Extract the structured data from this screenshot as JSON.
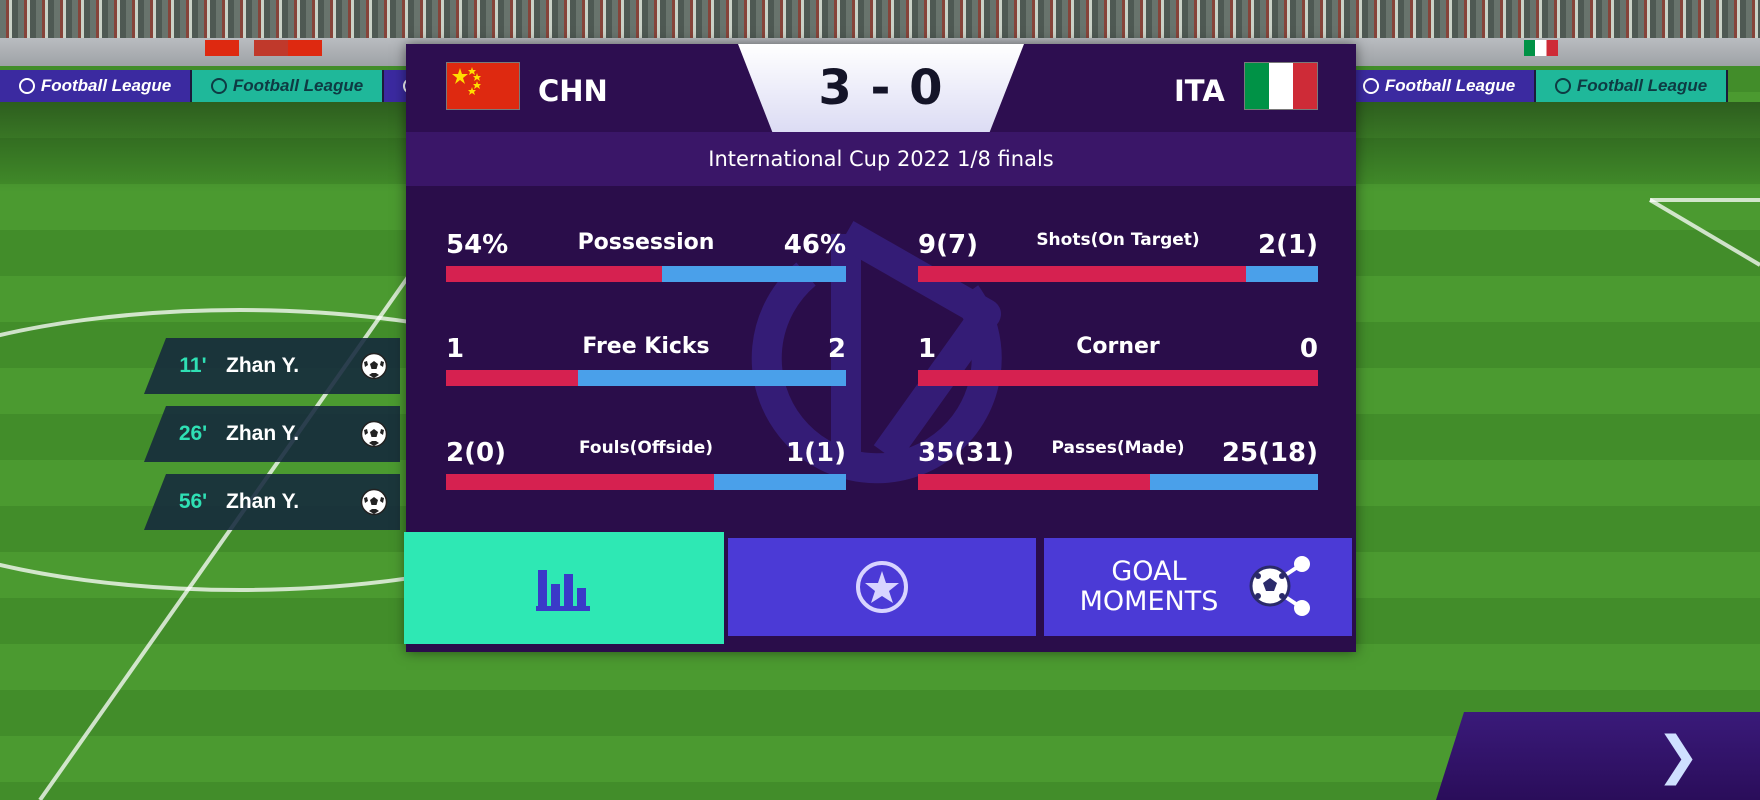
{
  "background": {
    "ad_boards": [
      {
        "text": "Football League",
        "style": "purple"
      },
      {
        "text": "Football League",
        "style": "teal"
      },
      {
        "text": "Football League",
        "style": "purple"
      },
      {
        "text": "",
        "style": "purple"
      },
      {
        "text": "",
        "style": "purple"
      },
      {
        "text": "",
        "style": "purple"
      },
      {
        "text": "Football League",
        "style": "teal"
      },
      {
        "text": "Football League",
        "style": "purple"
      },
      {
        "text": "Football League",
        "style": "teal"
      }
    ]
  },
  "goals": [
    {
      "minute": "11'",
      "scorer": "Zhan Y.",
      "icon": "soccer-ball-icon"
    },
    {
      "minute": "26'",
      "scorer": "Zhan Y.",
      "icon": "soccer-ball-icon"
    },
    {
      "minute": "56'",
      "scorer": "Zhan Y.",
      "icon": "soccer-ball-icon"
    }
  ],
  "match": {
    "home_code": "CHN",
    "away_code": "ITA",
    "score": "3 - 0",
    "competition": "International Cup 2022 1/8 finals",
    "home_flag": "china-flag",
    "away_flag": "italy-flag"
  },
  "stats": [
    {
      "label": "Possession",
      "home": "54%",
      "away": "46%",
      "home_share": 0.54,
      "label_size": "normal"
    },
    {
      "label": "Shots(On Target)",
      "home": "9(7)",
      "away": "2(1)",
      "home_share": 0.82,
      "label_size": "small"
    },
    {
      "label": "Free Kicks",
      "home": "1",
      "away": "2",
      "home_share": 0.33,
      "label_size": "normal"
    },
    {
      "label": "Corner",
      "home": "1",
      "away": "0",
      "home_share": 1.0,
      "label_size": "normal"
    },
    {
      "label": "Fouls(Offside)",
      "home": "2(0)",
      "away": "1(1)",
      "home_share": 0.67,
      "label_size": "small"
    },
    {
      "label": "Passes(Made)",
      "home": "35(31)",
      "away": "25(18)",
      "home_share": 0.58,
      "label_size": "small"
    }
  ],
  "tabs": {
    "stats_icon": "bar-chart-icon",
    "rating_icon": "star-circle-icon",
    "goal_moments_label": "GOAL\nMOMENTS",
    "goal_moments_icon": "share-ball-icon",
    "active": "stats"
  },
  "navigation": {
    "next_glyph": "❯"
  },
  "colors": {
    "panel_bg": "#2a0d4a",
    "home_bar": "#d62150",
    "away_bar": "#4aa0ea",
    "active_tab": "#2ee8b4",
    "tab": "#4b3ad6",
    "goal_minute": "#2fe0b4"
  }
}
